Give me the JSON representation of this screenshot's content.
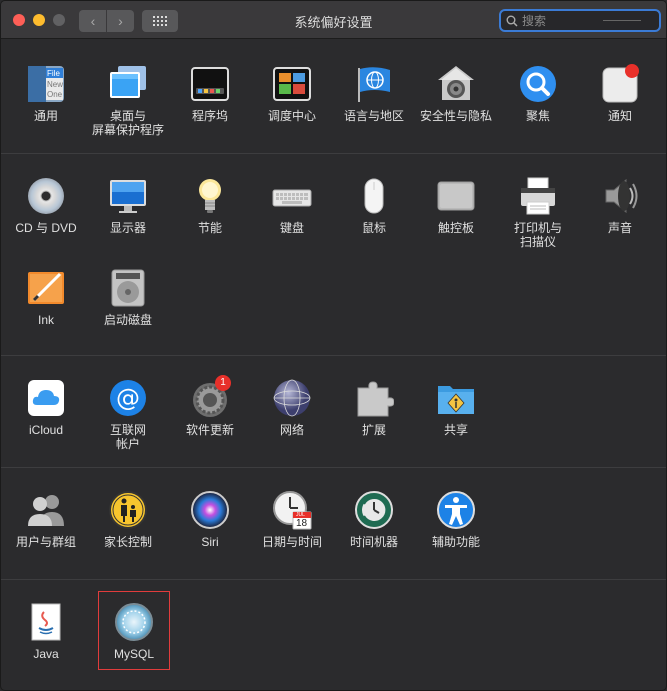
{
  "window": {
    "title": "系统偏好设置"
  },
  "search": {
    "placeholder": "搜索"
  },
  "sections": [
    {
      "items": [
        {
          "label": "通用",
          "icon": "general-icon"
        },
        {
          "label": "桌面与",
          "label2": "屏幕保护程序",
          "icon": "desktop-screensaver-icon"
        },
        {
          "label": "程序坞",
          "icon": "dock-icon"
        },
        {
          "label": "调度中心",
          "icon": "mission-control-icon"
        },
        {
          "label": "语言与地区",
          "icon": "language-region-icon"
        },
        {
          "label": "安全性与隐私",
          "icon": "security-privacy-icon"
        },
        {
          "label": "聚焦",
          "icon": "spotlight-icon"
        },
        {
          "label": "通知",
          "icon": "notifications-icon"
        }
      ]
    },
    {
      "items": [
        {
          "label": "CD 与 DVD",
          "icon": "cd-dvd-icon"
        },
        {
          "label": "显示器",
          "icon": "displays-icon"
        },
        {
          "label": "节能",
          "icon": "energy-saver-icon"
        },
        {
          "label": "键盘",
          "icon": "keyboard-icon"
        },
        {
          "label": "鼠标",
          "icon": "mouse-icon"
        },
        {
          "label": "触控板",
          "icon": "trackpad-icon"
        },
        {
          "label": "打印机与",
          "label2": "扫描仪",
          "icon": "printer-scanner-icon"
        },
        {
          "label": "声音",
          "icon": "sound-icon"
        },
        {
          "label": "Ink",
          "icon": "ink-icon"
        },
        {
          "label": "启动磁盘",
          "icon": "startup-disk-icon"
        }
      ]
    },
    {
      "items": [
        {
          "label": "iCloud",
          "icon": "icloud-icon"
        },
        {
          "label": "互联网",
          "label2": "帐户",
          "icon": "internet-accounts-icon"
        },
        {
          "label": "软件更新",
          "icon": "software-update-icon",
          "badge": "1"
        },
        {
          "label": "网络",
          "icon": "network-icon"
        },
        {
          "label": "扩展",
          "icon": "extensions-icon"
        },
        {
          "label": "共享",
          "icon": "sharing-icon"
        }
      ]
    },
    {
      "items": [
        {
          "label": "用户与群组",
          "icon": "users-groups-icon"
        },
        {
          "label": "家长控制",
          "icon": "parental-controls-icon"
        },
        {
          "label": "Siri",
          "icon": "siri-icon"
        },
        {
          "label": "日期与时间",
          "icon": "date-time-icon"
        },
        {
          "label": "时间机器",
          "icon": "time-machine-icon"
        },
        {
          "label": "辅助功能",
          "icon": "accessibility-icon"
        }
      ]
    },
    {
      "items": [
        {
          "label": "Java",
          "icon": "java-icon"
        },
        {
          "label": "MySQL",
          "icon": "mysql-icon"
        }
      ]
    }
  ],
  "icon_text": {
    "general_file": "File",
    "general_new": "New",
    "general_one": "One",
    "calendar_month": "JUL",
    "calendar_day": "18"
  },
  "colors": {
    "window_bg": "#2b2b2d",
    "titlebar_bg": "#3a393b",
    "accent": "#3b7bd5",
    "selection": "#e13c3c",
    "badge": "#e8302a"
  }
}
